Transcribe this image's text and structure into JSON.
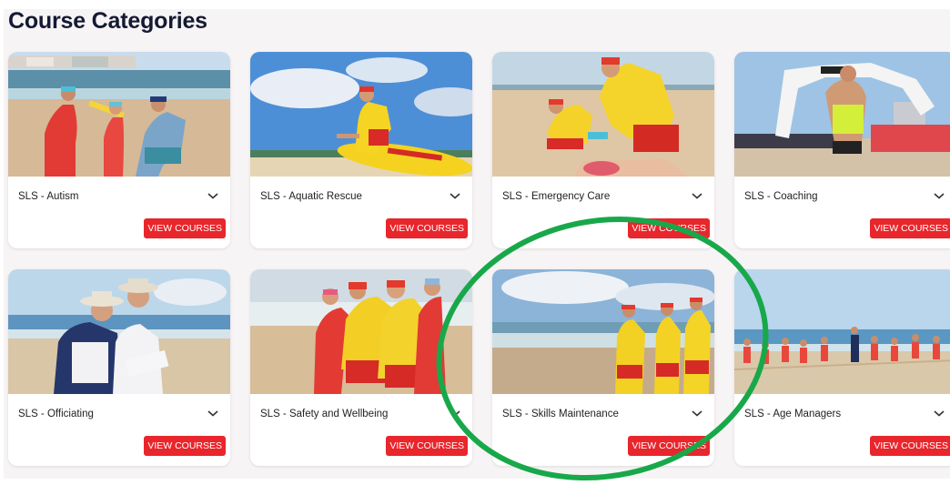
{
  "header": {
    "title": "Course Categories"
  },
  "cards": [
    {
      "label": "SLS - Autism",
      "button": "VIEW COURSES"
    },
    {
      "label": "SLS - Aquatic Rescue",
      "button": "VIEW COURSES"
    },
    {
      "label": "SLS - Emergency Care",
      "button": "VIEW COURSES"
    },
    {
      "label": "SLS - Coaching",
      "button": "VIEW COURSES"
    },
    {
      "label": "SLS - Officiating",
      "button": "VIEW COURSES"
    },
    {
      "label": "SLS - Safety and Wellbeing",
      "button": "VIEW COURSES"
    },
    {
      "label": "SLS - Skills Maintenance",
      "button": "VIEW COURSES"
    },
    {
      "label": "SLS - Age Managers",
      "button": "VIEW COURSES"
    }
  ],
  "colors": {
    "button": "#e8262c",
    "title": "#141a33",
    "highlight_ring": "#18a84a",
    "lifesaver_yellow": "#f2d21c",
    "lifesaver_red": "#e0262a"
  },
  "icons": {
    "expand": "chevron-down-icon"
  }
}
